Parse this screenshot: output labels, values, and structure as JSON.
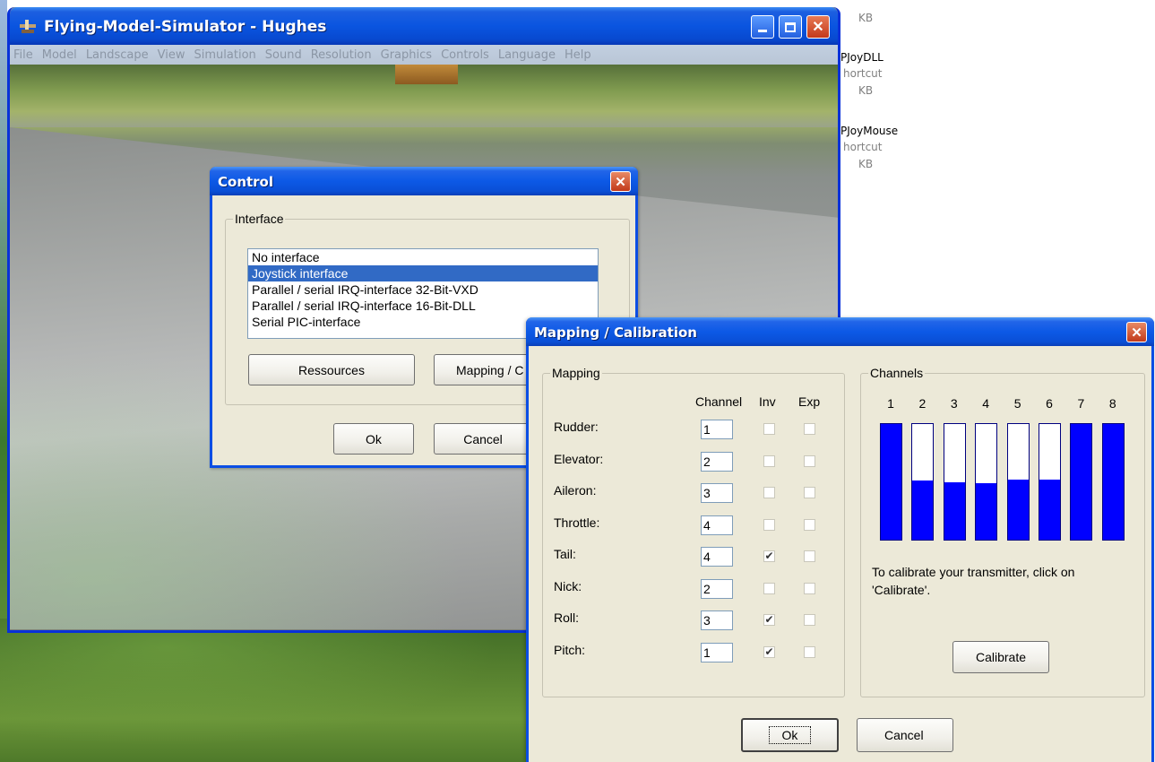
{
  "explorer": {
    "lines": [
      {
        "text": "KB",
        "style": "dim"
      },
      {
        "text": "PJoyDLL",
        "style": "name"
      },
      {
        "text": "hortcut",
        "style": "dim"
      },
      {
        "text": "KB",
        "style": "dim"
      },
      {
        "text": "PJoyMouse",
        "style": "name"
      },
      {
        "text": "hortcut",
        "style": "dim"
      },
      {
        "text": "KB",
        "style": "dim"
      }
    ]
  },
  "sim_window": {
    "title": "Flying-Model-Simulator - Hughes",
    "menu": [
      "File",
      "Model",
      "Landscape",
      "View",
      "Simulation",
      "Sound",
      "Resolution",
      "Graphics",
      "Controls",
      "Language",
      "Help"
    ]
  },
  "control_dialog": {
    "title": "Control",
    "group_label": "Interface",
    "interfaces": [
      {
        "label": "No interface",
        "selected": false
      },
      {
        "label": "Joystick interface",
        "selected": true
      },
      {
        "label": "Parallel / serial IRQ-interface 32-Bit-VXD",
        "selected": false
      },
      {
        "label": "Parallel / serial IRQ-interface 16-Bit-DLL",
        "selected": false
      },
      {
        "label": "Serial PIC-interface",
        "selected": false
      }
    ],
    "resources_label": "Ressources",
    "mapping_label": "Mapping / C",
    "ok_label": "Ok",
    "cancel_label": "Cancel"
  },
  "mapping_dialog": {
    "title": "Mapping / Calibration",
    "mapping_group": "Mapping",
    "col_channel": "Channel",
    "col_inv": "Inv",
    "col_exp": "Exp",
    "rows": [
      {
        "label": "Rudder:",
        "channel": "1",
        "inv": false,
        "exp": false
      },
      {
        "label": "Elevator:",
        "channel": "2",
        "inv": false,
        "exp": false
      },
      {
        "label": "Aileron:",
        "channel": "3",
        "inv": false,
        "exp": false
      },
      {
        "label": "Throttle:",
        "channel": "4",
        "inv": false,
        "exp": false
      },
      {
        "label": "Tail:",
        "channel": "4",
        "inv": true,
        "exp": false
      },
      {
        "label": "Nick:",
        "channel": "2",
        "inv": false,
        "exp": false
      },
      {
        "label": "Roll:",
        "channel": "3",
        "inv": true,
        "exp": false
      },
      {
        "label": "Pitch:",
        "channel": "1",
        "inv": true,
        "exp": false
      }
    ],
    "channels_group": "Channels",
    "channels": [
      {
        "num": "1",
        "level": 1.0
      },
      {
        "num": "2",
        "level": 0.51
      },
      {
        "num": "3",
        "level": 0.5
      },
      {
        "num": "4",
        "level": 0.49
      },
      {
        "num": "5",
        "level": 0.52
      },
      {
        "num": "6",
        "level": 0.52
      },
      {
        "num": "7",
        "level": 1.0
      },
      {
        "num": "8",
        "level": 1.0
      }
    ],
    "calibrate_hint": "To calibrate your transmitter, click on 'Calibrate'.",
    "calibrate_label": "Calibrate",
    "ok_label": "Ok",
    "cancel_label": "Cancel"
  },
  "colors": {
    "xp_blue": "#0b4ee4",
    "selection": "#316ac5",
    "channel_fill": "#0000ff",
    "dialog_bg": "#ece9d8"
  }
}
